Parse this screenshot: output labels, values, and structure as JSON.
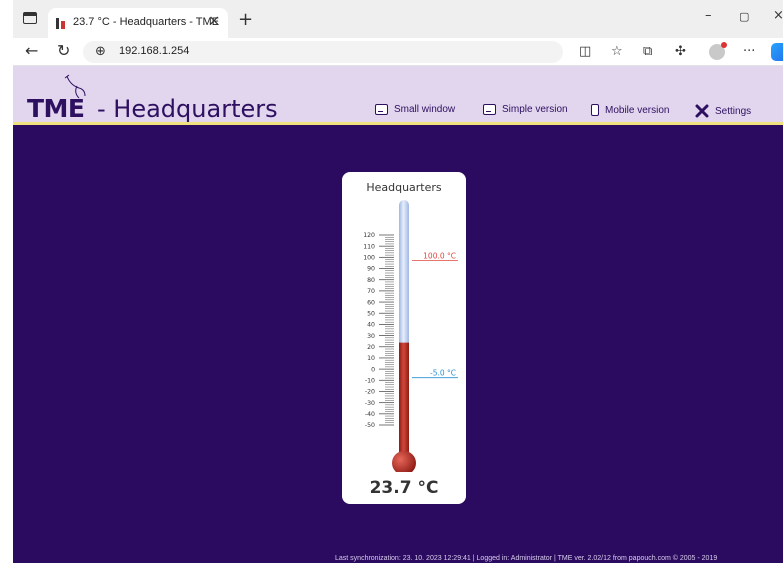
{
  "browser": {
    "tab_title": "23.7 °C - Headquarters - TME",
    "tab_close": "×",
    "new_tab": "+",
    "url": "192.168.1.254",
    "window_controls": [
      "–",
      "▢",
      "×"
    ],
    "more_icon": "···"
  },
  "header": {
    "logo": "TME",
    "title": "- Headquarters",
    "menu": [
      {
        "label": "Small window",
        "icon": "window-icon"
      },
      {
        "label": "Simple version",
        "icon": "simple-icon"
      },
      {
        "label": "Mobile version",
        "icon": "phone-icon"
      },
      {
        "label": "Settings",
        "icon": "tools-icon"
      }
    ]
  },
  "thermometer": {
    "title": "Headquarters",
    "value_text": "23.7 °C",
    "current_value": 23.7,
    "scale_labels": [
      "120",
      "110",
      "100",
      "90",
      "80",
      "70",
      "60",
      "50",
      "40",
      "30",
      "20",
      "10",
      "0",
      "-10",
      "-20",
      "-30",
      "-40",
      "-50"
    ],
    "scale_min": -50,
    "scale_max": 120,
    "upper_limit": 100.0,
    "upper_limit_label": "100.0 °C",
    "lower_limit": -5.0,
    "lower_limit_label": "-5.0 °C",
    "colors": {
      "mercury": "#b72a20",
      "upper": "#e0463e",
      "lower": "#2a8fd0",
      "tube": "#c9d8f0"
    }
  },
  "footer": {
    "text": "Last synchronization: 23. 10. 2023 12:29:41 | Logged in: Administrator | TME ver. 2.02/12 from papouch.com © 2005 - 2019"
  },
  "colors": {
    "header_bg": "#e2d5ee",
    "main_bg": "#2b0b5f",
    "accent": "#2e1060",
    "header_line": "#f1e07e"
  }
}
